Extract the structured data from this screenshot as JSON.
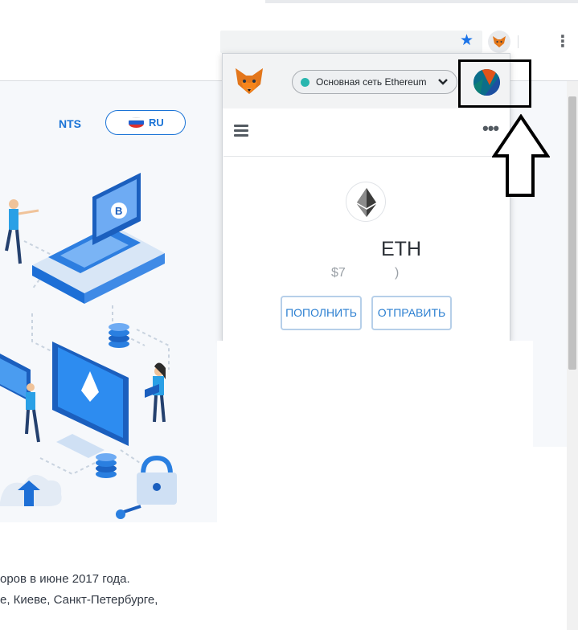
{
  "browser": {
    "bookmark_icon": "star-icon",
    "extension_icon": "metamask-fox-icon",
    "menu_icon": "kebab-menu-icon"
  },
  "site": {
    "nav_link": "NTS",
    "language_button": "RU",
    "language_flag": "russia-flag-icon",
    "body_lines": [
      "оров в июне 2017 года.",
      "е, Киеве, Санкт-Петербурге,"
    ]
  },
  "metamask": {
    "network_label": "Основная сеть Ethereum",
    "network_status_color": "#29b6af",
    "account_icon": "account-identicon-icon",
    "menu_icon": "hamburger-icon",
    "options_icon": "more-options-icon",
    "token_icon": "ethereum-icon",
    "balance_eth": "ETH",
    "balance_fiat_prefix": "$7",
    "balance_fiat_suffix": ")",
    "deposit_button": "ПОПОЛНИТЬ",
    "send_button": "ОТПРАВИТЬ"
  },
  "colors": {
    "site_accent": "#1a73d6",
    "metamask_button_text": "#2b7fd1"
  }
}
